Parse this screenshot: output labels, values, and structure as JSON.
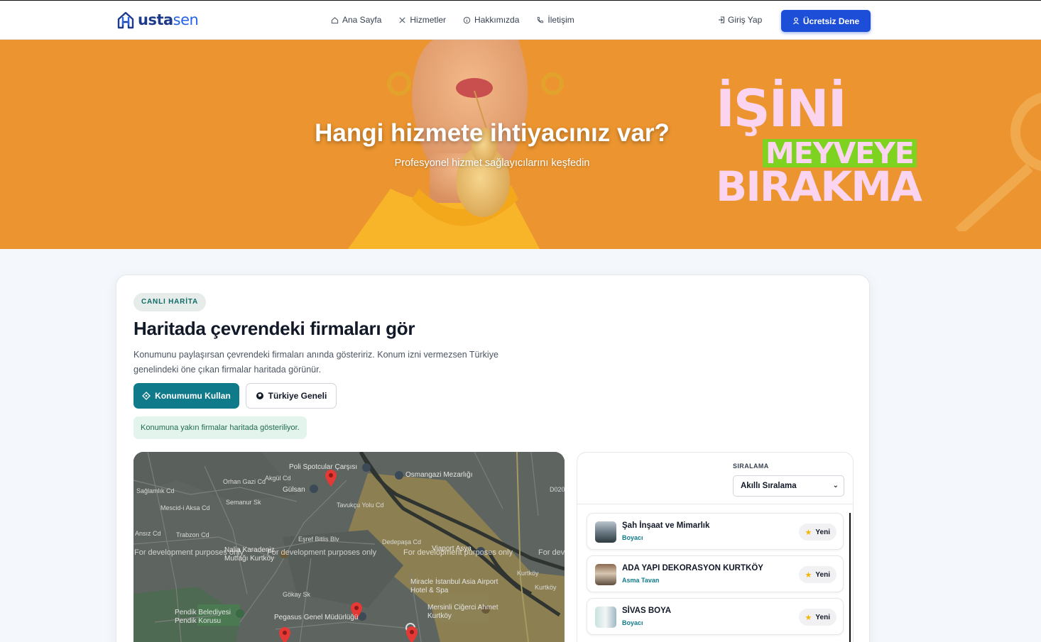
{
  "nav": {
    "logo_usta": "usta",
    "logo_sen": "sen",
    "links": [
      {
        "label": "Ana Sayfa",
        "icon": "home-icon"
      },
      {
        "label": "Hizmetler",
        "icon": "tools-icon"
      },
      {
        "label": "Hakkımızda",
        "icon": "info-icon"
      },
      {
        "label": "İletişim",
        "icon": "phone-icon"
      }
    ],
    "login": "Giriş Yap",
    "cta": "Ücretsiz Dene"
  },
  "hero": {
    "title": "Hangi hizmete ihtiyacınız var?",
    "subtitle": "Profesyonel hizmet sağlayıcılarını keşfedin",
    "promo": {
      "line1": "İŞİNİ",
      "line2": "MEYVEYE",
      "line3": "BIRAKMA"
    }
  },
  "section": {
    "badge": "CANLI HARİTA",
    "title": "Haritada çevrendeki firmaları gör",
    "description": "Konumunu paylaşırsan çevrendeki firmaları anında gösteririz. Konum izni vermezsen Türkiye genelindeki öne çıkan firmalar haritada görünür.",
    "btn_location": "Konumumu Kullan",
    "btn_turkey": "Türkiye Geneli",
    "status": "Konumuna yakın firmalar haritada gösteriliyor."
  },
  "map": {
    "dev_notice": "For development purposes only",
    "labels": [
      "Poli Spotcular Çarşısı",
      "Osmangazi Mezarlığı",
      "Gülsan",
      "Orhan Gazi Cd",
      "Akgül Cd",
      "Semanur Sk",
      "Mescid-i Aksa Cd",
      "Trabzon Cd",
      "Eşref Bitlis Blv",
      "Dedepaşa Cd",
      "Viaport Asya",
      "Kurtköy",
      "Miracle İstanbul Asia Airport Hotel & Spa",
      "Mersinli Ciğerci Ahmet Kurtköy",
      "Pendik Belediyesi Pendik Korusu",
      "Pegasus Genel Müdürlüğü",
      "Nalia Karadeniz Mutfağı Kurtköy",
      "Gökay Sk",
      "Tavukçu Yolu Cd",
      "Sağlamlık Cd",
      "Kurtköy",
      "D020",
      "Ansız Cd"
    ]
  },
  "list": {
    "sort_label": "SIRALAMA",
    "sort_value": "Akıllı Sıralama",
    "items": [
      {
        "name": "Şah İnşaat ve Mimarlık",
        "category": "Boyacı",
        "badge": "Yeni"
      },
      {
        "name": "ADA YAPI DEKORASYON KURTKÖY",
        "category": "Asma Tavan",
        "badge": "Yeni"
      },
      {
        "name": "SİVAS BOYA",
        "category": "Boyacı",
        "badge": "Yeni"
      }
    ]
  },
  "colors": {
    "brand": "#1d4ed8",
    "hero_bg": "#ec9530",
    "teal": "#0f7a8a",
    "promo_pink": "#fbd5ef",
    "promo_green": "#7ed321"
  }
}
